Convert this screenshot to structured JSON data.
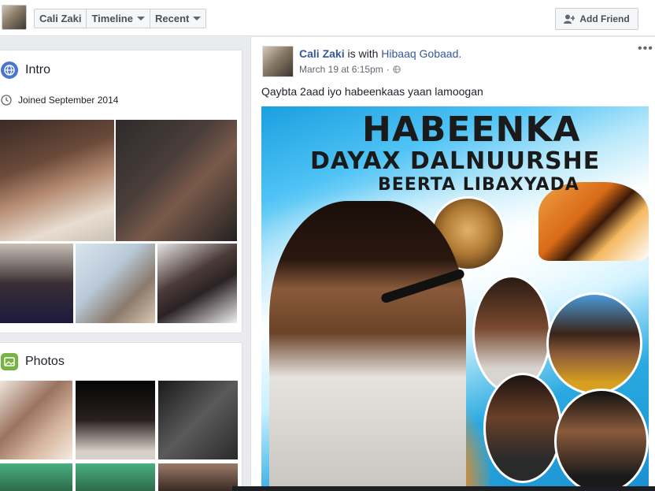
{
  "topbar": {
    "profile_name": "Cali Zaki",
    "tabs": [
      {
        "label": "Timeline",
        "has_dropdown": true
      },
      {
        "label": "Recent",
        "has_dropdown": true
      }
    ],
    "add_friend_label": "Add Friend"
  },
  "intro": {
    "title": "Intro",
    "joined": "Joined September 2014"
  },
  "photos": {
    "title": "Photos"
  },
  "post": {
    "author": "Cali Zaki",
    "with_text": "is with",
    "tagged": "Hibaaq Gobaad.",
    "timestamp": "March 19 at 6:15pm",
    "separator": "·",
    "more_label": "•••",
    "text": "Qaybta 2aad iyo habeenkaas yaan lamoogan",
    "poster": {
      "line1": "HABEENKA",
      "line2": "DAYAX DALNUURSHE",
      "line3": "BEERTA LIBAXYADA"
    }
  },
  "colors": {
    "link": "#365899",
    "intro_icon": "#4b76d0",
    "photos_icon": "#76b343"
  }
}
